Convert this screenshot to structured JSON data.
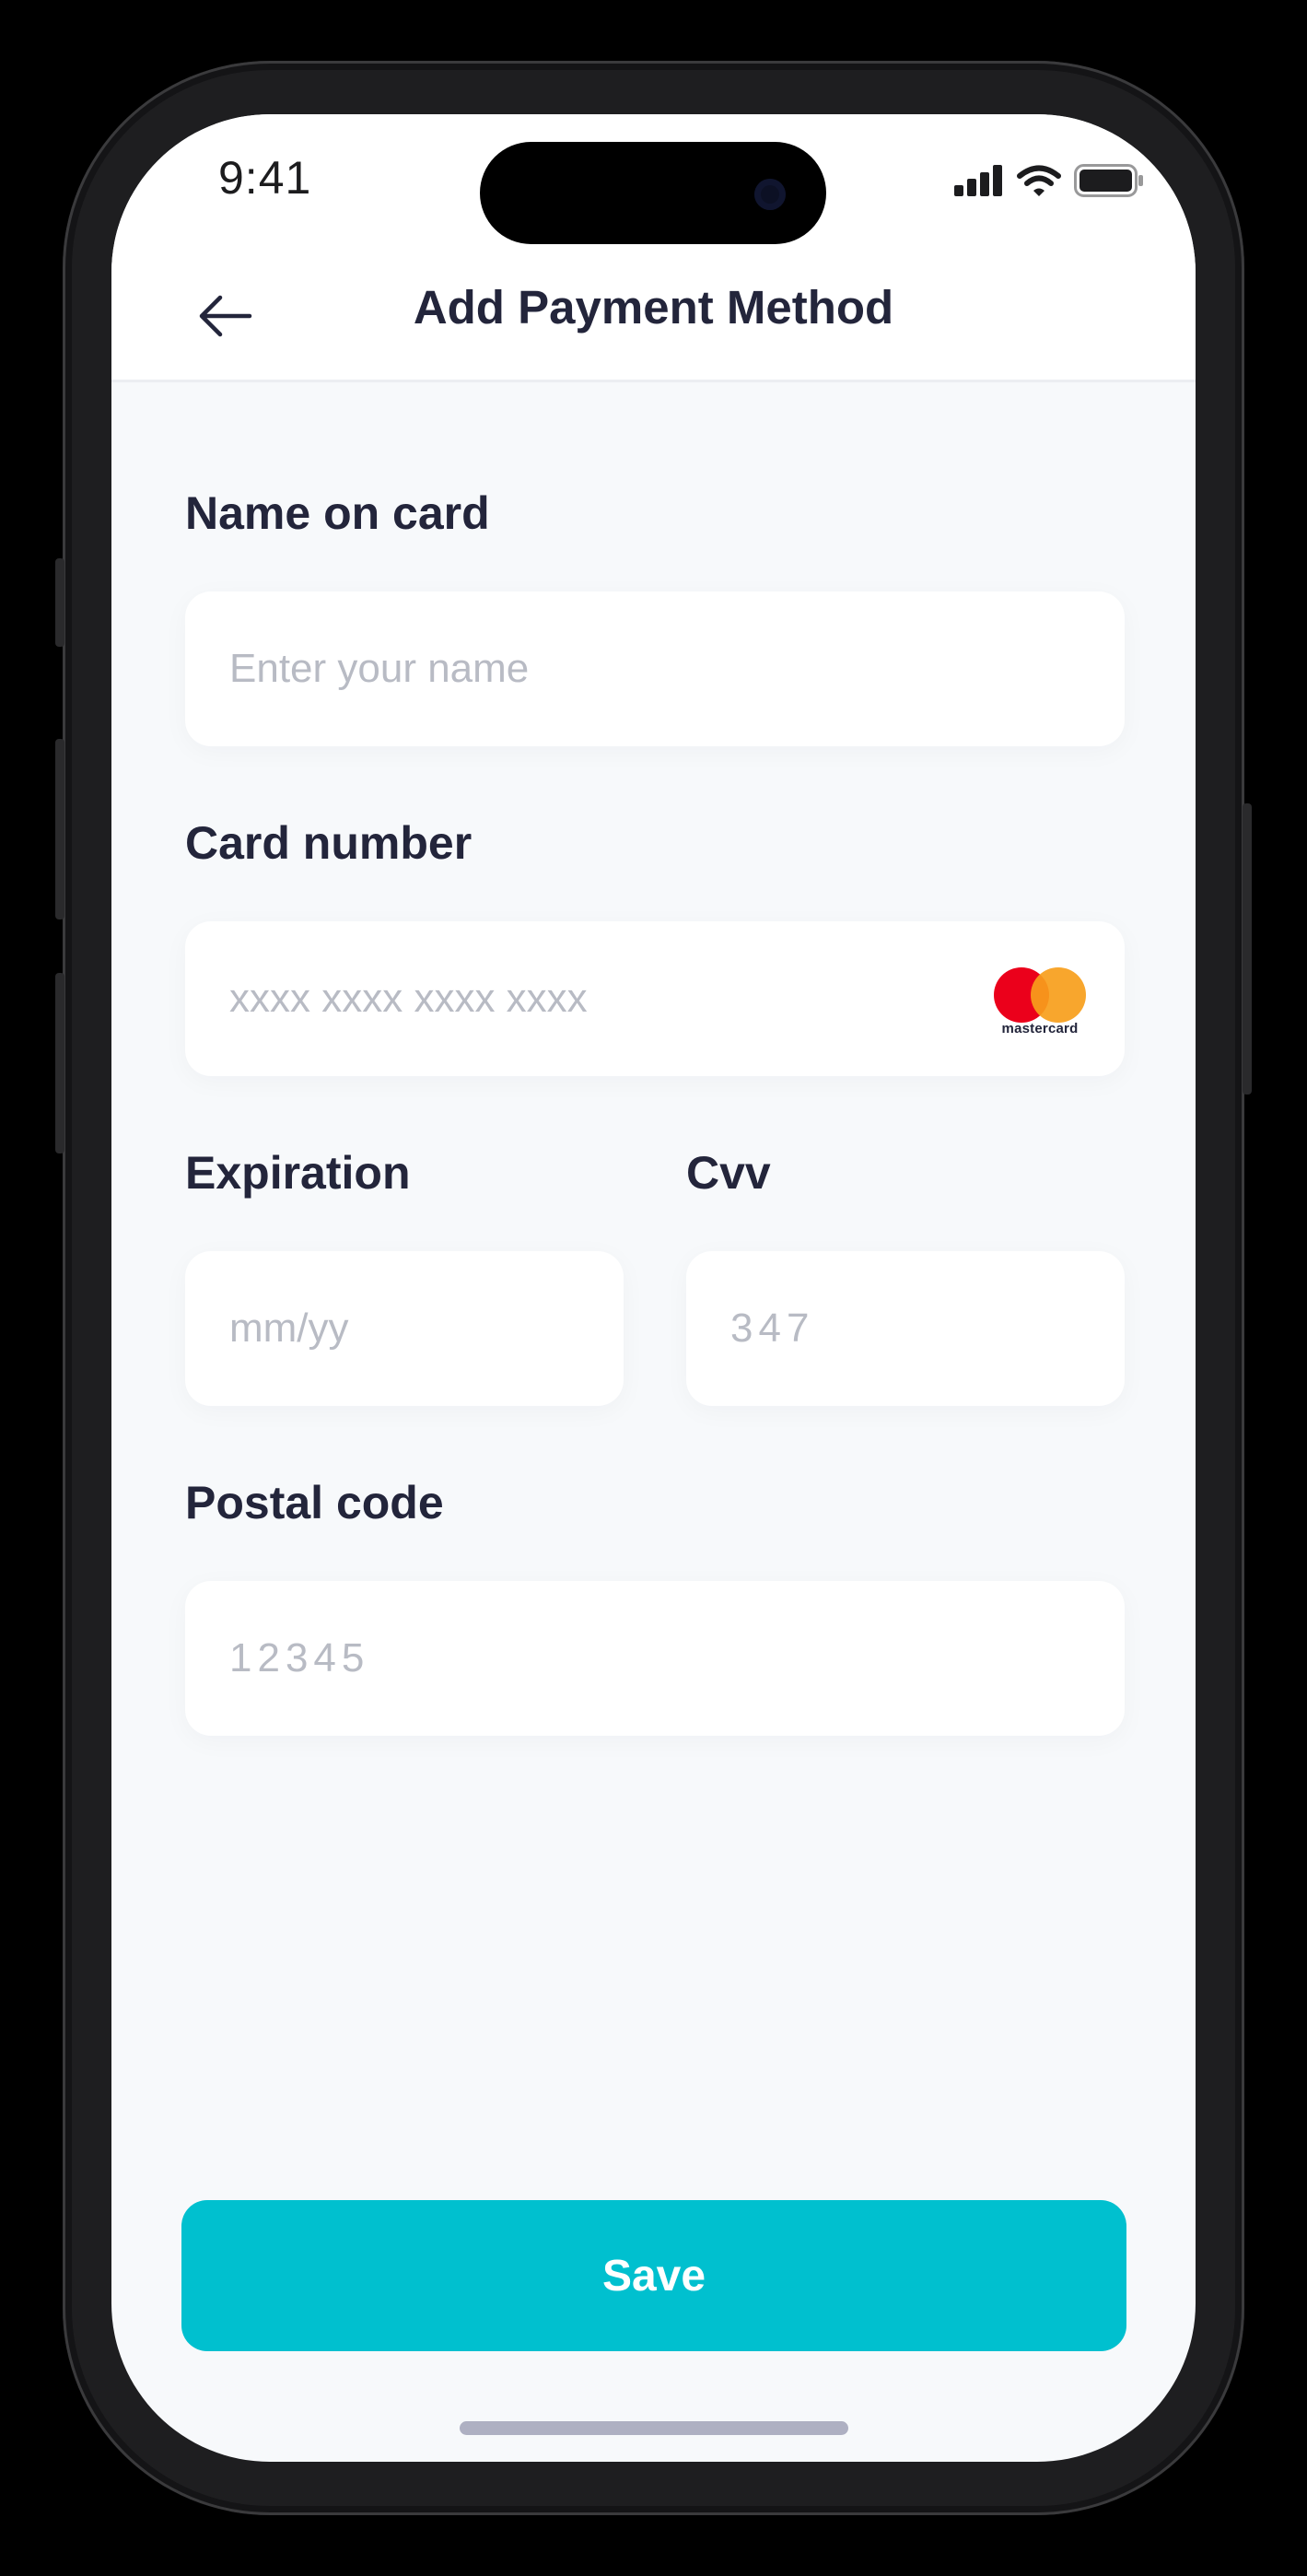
{
  "status_bar": {
    "time": "9:41",
    "icons": [
      "cellular-signal-icon",
      "wifi-icon",
      "battery-icon"
    ]
  },
  "header": {
    "back_icon": "arrow-left-icon",
    "title": "Add Payment Method"
  },
  "form": {
    "name": {
      "label": "Name on card",
      "value": "",
      "placeholder": "Enter your name"
    },
    "card_number": {
      "label": "Card number",
      "value": "",
      "placeholder": "xxxx xxxx xxxx xxxx",
      "brand_icon": "mastercard-logo",
      "brand_text": "mastercard"
    },
    "expiration": {
      "label": "Expiration",
      "value": "",
      "placeholder": "mm/yy"
    },
    "cvv": {
      "label": "Cvv",
      "value": "",
      "placeholder": "347"
    },
    "postal_code": {
      "label": "Postal code",
      "value": "",
      "placeholder": "12345"
    }
  },
  "actions": {
    "save_label": "Save"
  },
  "colors": {
    "accent": "#00c0cf",
    "text_dark": "#23253b",
    "placeholder": "#b8bbc4",
    "background": "#f7f9fb",
    "mastercard_red": "#eb001b",
    "mastercard_orange": "#f79e1b"
  }
}
